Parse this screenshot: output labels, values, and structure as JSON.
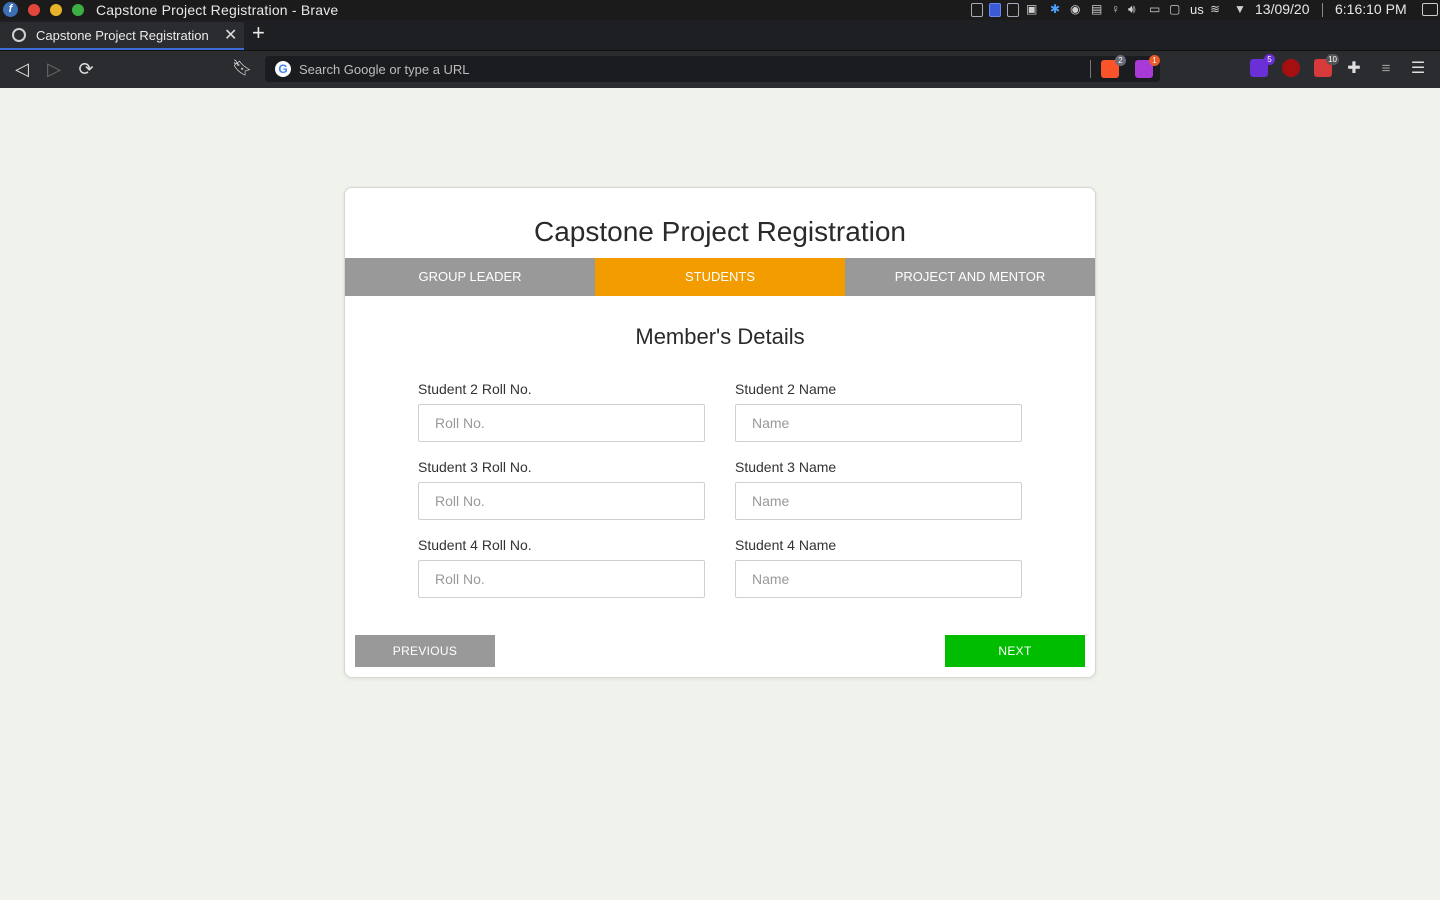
{
  "os": {
    "window_title": "Capstone Project Registration - Brave",
    "keyboard_layout": "us",
    "date": "13/09/20",
    "time": "6:16:10 PM"
  },
  "browser": {
    "tab_title": "Capstone Project Registration",
    "url_placeholder": "Search Google or type a URL",
    "extensions": [
      {
        "icon": "brave-shields-icon",
        "badge": "2",
        "color": "#fb542b"
      },
      {
        "icon": "brave-rewards-icon",
        "badge": "1",
        "color": "#a83ad8"
      },
      {
        "icon": "extension-icon",
        "badge": "5",
        "color": "#6a2fd6"
      },
      {
        "icon": "ublock-origin-icon",
        "badge": "",
        "color": "#a50f0f"
      },
      {
        "icon": "extension-icon",
        "badge": "10",
        "color": "#d63a3a"
      }
    ]
  },
  "page": {
    "title": "Capstone Project Registration",
    "steps": [
      {
        "label": "GROUP LEADER",
        "active": false
      },
      {
        "label": "STUDENTS",
        "active": true
      },
      {
        "label": "PROJECT AND MENTOR",
        "active": false
      }
    ],
    "section_title": "Member's Details",
    "fields": [
      {
        "label": "Student 2 Roll No.",
        "placeholder": "Roll No."
      },
      {
        "label": "Student 2 Name",
        "placeholder": "Name"
      },
      {
        "label": "Student 3 Roll No.",
        "placeholder": "Roll No."
      },
      {
        "label": "Student 3 Name",
        "placeholder": "Name"
      },
      {
        "label": "Student 4 Roll No.",
        "placeholder": "Roll No."
      },
      {
        "label": "Student 4 Name",
        "placeholder": "Name"
      }
    ],
    "previous_label": "PREVIOUS",
    "next_label": "NEXT",
    "colors": {
      "active_step": "#f39c00",
      "inactive_step": "#999999",
      "next_button": "#00bd00",
      "previous_button": "#999999",
      "background": "#f0f2ec"
    }
  }
}
